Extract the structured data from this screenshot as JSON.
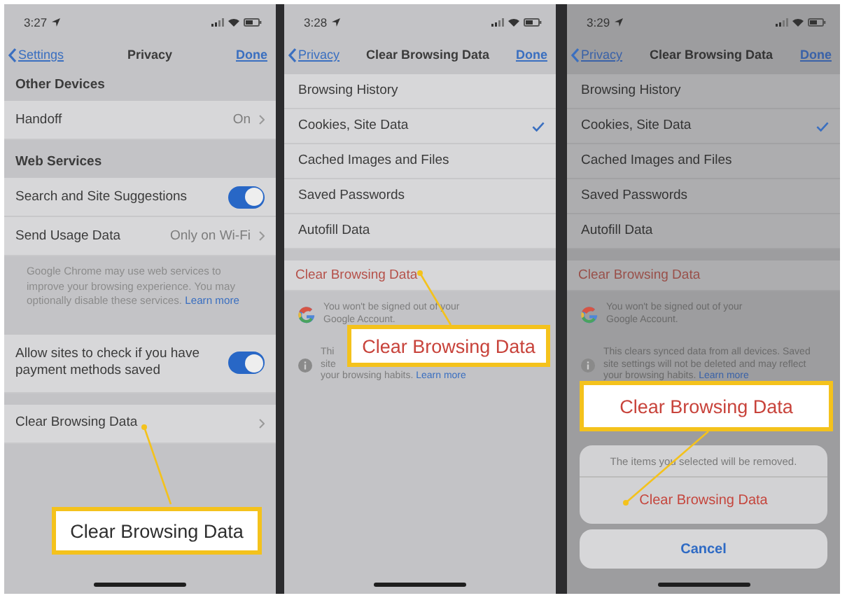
{
  "panels": [
    {
      "dimmed": false,
      "status": {
        "time": "3:27"
      },
      "nav": {
        "back": "Settings",
        "title": "Privacy",
        "action": "Done"
      },
      "sections": [
        {
          "header": "Other Devices",
          "rows": [
            {
              "kind": "value",
              "label": "Handoff",
              "value": "On"
            }
          ]
        },
        {
          "header": "Web Services",
          "rows": [
            {
              "kind": "toggle",
              "label": "Search and Site Suggestions",
              "on": true
            },
            {
              "kind": "value",
              "label": "Send Usage Data",
              "value": "Only on Wi-Fi"
            }
          ],
          "footer": {
            "text": "Google Chrome may use web services to improve your browsing experience. You may optionally disable these services.",
            "link": "Learn more"
          }
        },
        {
          "rows": [
            {
              "kind": "toggle",
              "label": "Allow sites to check if you have payment methods saved",
              "on": true
            }
          ]
        },
        {
          "rows": [
            {
              "kind": "nav",
              "label": "Clear Browsing Data"
            }
          ]
        }
      ],
      "callout": {
        "text": "Clear Browsing Data",
        "color": "#2e2e2e"
      }
    },
    {
      "dimmed": false,
      "status": {
        "time": "3:28"
      },
      "nav": {
        "back": "Privacy",
        "title": "Clear Browsing Data",
        "action": "Done"
      },
      "sections": [
        {
          "rows": [
            {
              "kind": "check",
              "label": "Browsing History",
              "checked": false
            },
            {
              "kind": "check",
              "label": "Cookies, Site Data",
              "checked": true
            },
            {
              "kind": "check",
              "label": "Cached Images and Files",
              "checked": false
            },
            {
              "kind": "check",
              "label": "Saved Passwords",
              "checked": false
            },
            {
              "kind": "check",
              "label": "Autofill Data",
              "checked": false
            }
          ]
        },
        {
          "rows": [
            {
              "kind": "action",
              "label": "Clear Browsing Data"
            }
          ]
        }
      ],
      "notes": [
        {
          "kind": "google",
          "lines": [
            "You won't be signed out of your",
            "Google Account."
          ]
        },
        {
          "kind": "info",
          "lines": [
            "Thi",
            "site",
            "your browsing habits."
          ],
          "link": "Learn more"
        }
      ],
      "callout": {
        "text": "Clear Browsing Data",
        "color": "#c8433b"
      }
    },
    {
      "dimmed": true,
      "status": {
        "time": "3:29"
      },
      "nav": {
        "back": "Privacy",
        "title": "Clear Browsing Data",
        "action": "Done"
      },
      "sections": [
        {
          "rows": [
            {
              "kind": "check",
              "label": "Browsing History",
              "checked": false
            },
            {
              "kind": "check",
              "label": "Cookies, Site Data",
              "checked": true
            },
            {
              "kind": "check",
              "label": "Cached Images and Files",
              "checked": false
            },
            {
              "kind": "check",
              "label": "Saved Passwords",
              "checked": false
            },
            {
              "kind": "check",
              "label": "Autofill Data",
              "checked": false
            }
          ]
        },
        {
          "rows": [
            {
              "kind": "action",
              "label": "Clear Browsing Data"
            }
          ]
        }
      ],
      "notes": [
        {
          "kind": "google",
          "lines": [
            "You won't be signed out of your",
            "Google Account."
          ]
        },
        {
          "kind": "info",
          "lines": [
            "This clears synced data from all devices. Saved",
            "site settings will not be deleted and may reflect",
            "your browsing habits."
          ],
          "link": "Learn more"
        }
      ],
      "sheet": {
        "message": "The items you selected will be removed.",
        "confirm": "Clear Browsing Data",
        "cancel": "Cancel"
      },
      "callout": {
        "text": "Clear Browsing Data",
        "color": "#c8433b"
      }
    }
  ]
}
